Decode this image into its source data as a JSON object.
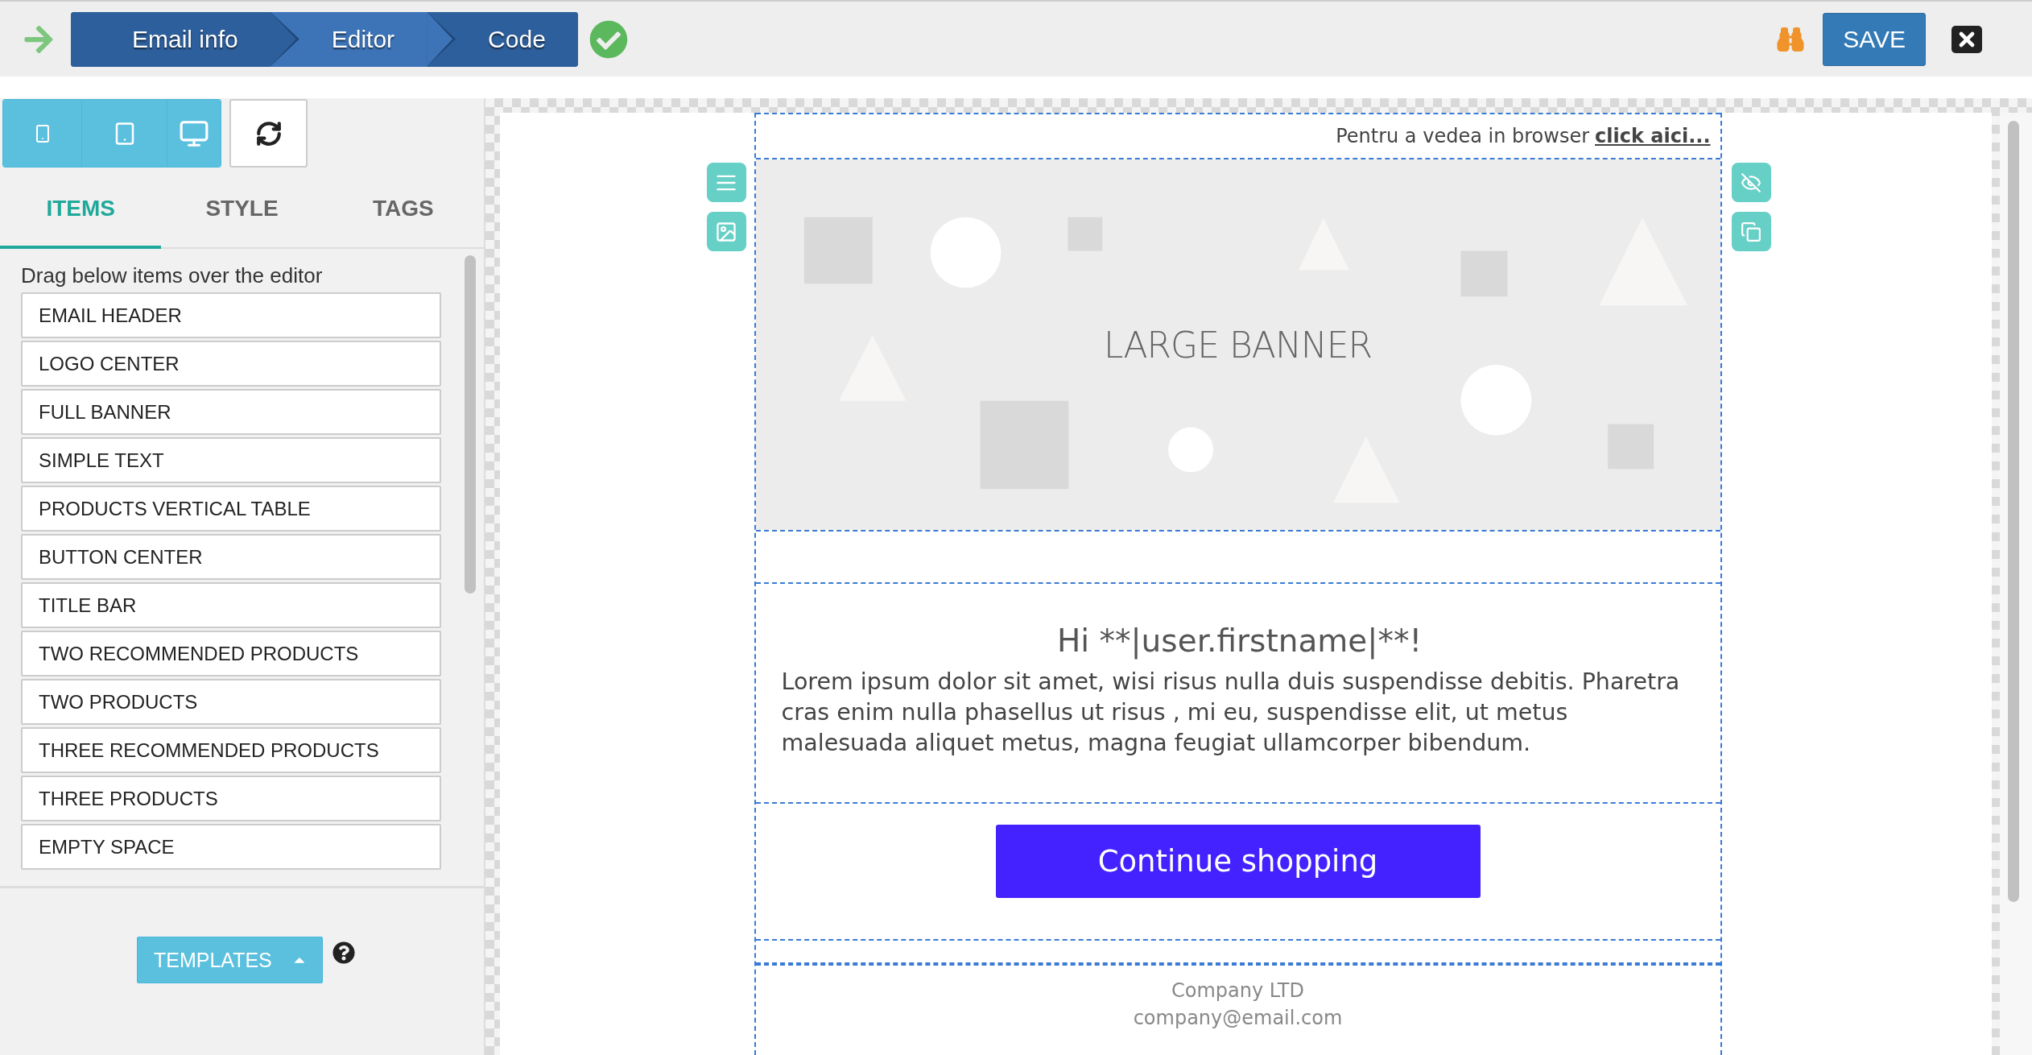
{
  "wizard": {
    "steps": [
      {
        "label": "Email info",
        "selected": false
      },
      {
        "label": "Editor",
        "selected": true
      },
      {
        "label": "Code",
        "selected": false
      }
    ]
  },
  "save_button": "SAVE",
  "panel_tabs": [
    {
      "label": "ITEMS",
      "selected": true
    },
    {
      "label": "STYLE",
      "selected": false
    },
    {
      "label": "TAGS",
      "selected": false
    }
  ],
  "items_hint": "Drag below items over the editor",
  "items": [
    "EMAIL HEADER",
    "LOGO CENTER",
    "FULL BANNER",
    "SIMPLE TEXT",
    "PRODUCTS VERTICAL TABLE",
    "BUTTON CENTER",
    "TITLE BAR",
    "TWO RECOMMENDED PRODUCTS",
    "TWO PRODUCTS",
    "THREE RECOMMENDED PRODUCTS",
    "THREE PRODUCTS",
    "EMPTY SPACE"
  ],
  "templates_button": "TEMPLATES",
  "email": {
    "preheader": {
      "text": "Pentru a vedea in browser",
      "link": "click aici..."
    },
    "banner": "LARGE BANNER",
    "greeting": "Hi **|user.firstname|**!",
    "body": "Lorem ipsum dolor sit amet, wisi risus nulla duis suspendisse debitis. Pharetra cras enim nulla phasellus ut risus , mi eu, suspendisse elit, ut metus malesuada aliquet metus, magna feugiat ullamcorper bibendum.",
    "cta": "Continue shopping",
    "footer": [
      "Company LTD",
      "company@email.com"
    ]
  }
}
